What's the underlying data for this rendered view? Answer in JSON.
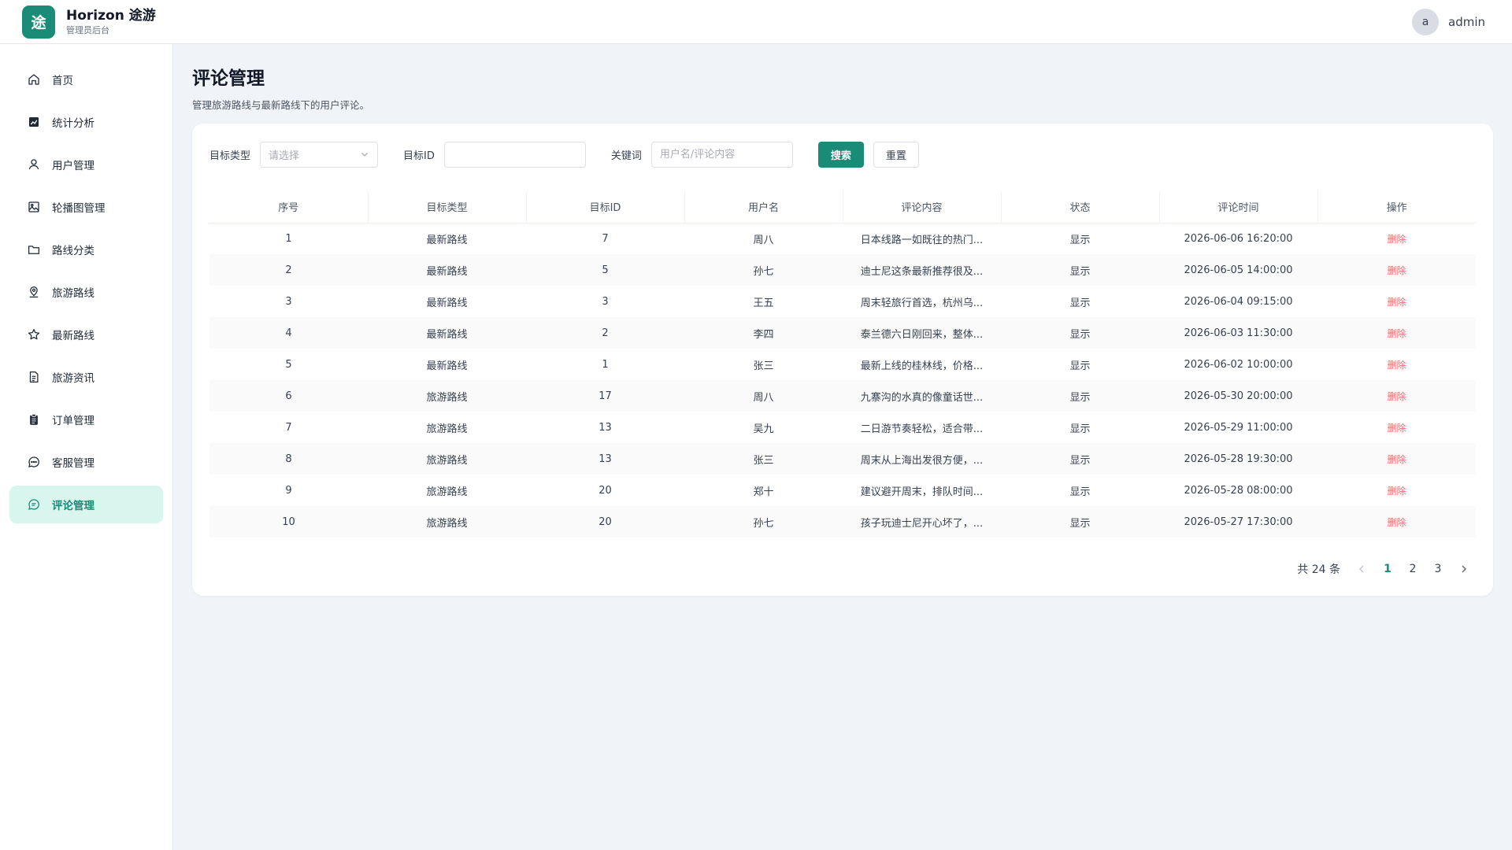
{
  "header": {
    "logo_char": "途",
    "title": "Horizon 途游",
    "subtitle": "管理员后台",
    "avatar_char": "a",
    "username": "admin"
  },
  "sidebar": {
    "items": [
      {
        "label": "首页",
        "icon": "home-icon"
      },
      {
        "label": "统计分析",
        "icon": "chart-icon"
      },
      {
        "label": "用户管理",
        "icon": "user-icon"
      },
      {
        "label": "轮播图管理",
        "icon": "image-icon"
      },
      {
        "label": "路线分类",
        "icon": "folder-icon"
      },
      {
        "label": "旅游路线",
        "icon": "location-icon"
      },
      {
        "label": "最新路线",
        "icon": "star-icon"
      },
      {
        "label": "旅游资讯",
        "icon": "document-icon"
      },
      {
        "label": "订单管理",
        "icon": "clipboard-icon"
      },
      {
        "label": "客服管理",
        "icon": "chat-icon"
      },
      {
        "label": "评论管理",
        "icon": "comment-icon",
        "active": true
      }
    ]
  },
  "page": {
    "title": "评论管理",
    "description": "管理旅游路线与最新路线下的用户评论。"
  },
  "filters": {
    "target_type_label": "目标类型",
    "target_type_placeholder": "请选择",
    "target_id_label": "目标ID",
    "target_id_value": "",
    "keyword_label": "关键词",
    "keyword_placeholder": "用户名/评论内容",
    "search_label": "搜索",
    "reset_label": "重置"
  },
  "table": {
    "columns": [
      "序号",
      "目标类型",
      "目标ID",
      "用户名",
      "评论内容",
      "状态",
      "评论时间",
      "操作"
    ],
    "rows": [
      {
        "no": "1",
        "type": "最新路线",
        "target_id": "7",
        "user": "周八",
        "content": "日本线路一如既往的热门...",
        "status": "显示",
        "time": "2026-06-06 16:20:00",
        "action": "删除"
      },
      {
        "no": "2",
        "type": "最新路线",
        "target_id": "5",
        "user": "孙七",
        "content": "迪士尼这条最新推荐很及...",
        "status": "显示",
        "time": "2026-06-05 14:00:00",
        "action": "删除"
      },
      {
        "no": "3",
        "type": "最新路线",
        "target_id": "3",
        "user": "王五",
        "content": "周末轻旅行首选，杭州乌...",
        "status": "显示",
        "time": "2026-06-04 09:15:00",
        "action": "删除"
      },
      {
        "no": "4",
        "type": "最新路线",
        "target_id": "2",
        "user": "李四",
        "content": "泰兰德六日刚回来，整体...",
        "status": "显示",
        "time": "2026-06-03 11:30:00",
        "action": "删除"
      },
      {
        "no": "5",
        "type": "最新路线",
        "target_id": "1",
        "user": "张三",
        "content": "最新上线的桂林线，价格...",
        "status": "显示",
        "time": "2026-06-02 10:00:00",
        "action": "删除"
      },
      {
        "no": "6",
        "type": "旅游路线",
        "target_id": "17",
        "user": "周八",
        "content": "九寨沟的水真的像童话世...",
        "status": "显示",
        "time": "2026-05-30 20:00:00",
        "action": "删除"
      },
      {
        "no": "7",
        "type": "旅游路线",
        "target_id": "13",
        "user": "吴九",
        "content": "二日游节奏轻松，适合带...",
        "status": "显示",
        "time": "2026-05-29 11:00:00",
        "action": "删除"
      },
      {
        "no": "8",
        "type": "旅游路线",
        "target_id": "13",
        "user": "张三",
        "content": "周末从上海出发很方便，...",
        "status": "显示",
        "time": "2026-05-28 19:30:00",
        "action": "删除"
      },
      {
        "no": "9",
        "type": "旅游路线",
        "target_id": "20",
        "user": "郑十",
        "content": "建议避开周末，排队时间...",
        "status": "显示",
        "time": "2026-05-28 08:00:00",
        "action": "删除"
      },
      {
        "no": "10",
        "type": "旅游路线",
        "target_id": "20",
        "user": "孙七",
        "content": "孩子玩迪士尼开心坏了，...",
        "status": "显示",
        "time": "2026-05-27 17:30:00",
        "action": "删除"
      }
    ]
  },
  "pagination": {
    "total_text": "共 24 条",
    "pages": [
      "1",
      "2",
      "3"
    ],
    "current": "1"
  },
  "colors": {
    "accent": "#1a8b77",
    "active_bg": "#d8f6ee",
    "danger": "#f56c6c"
  }
}
